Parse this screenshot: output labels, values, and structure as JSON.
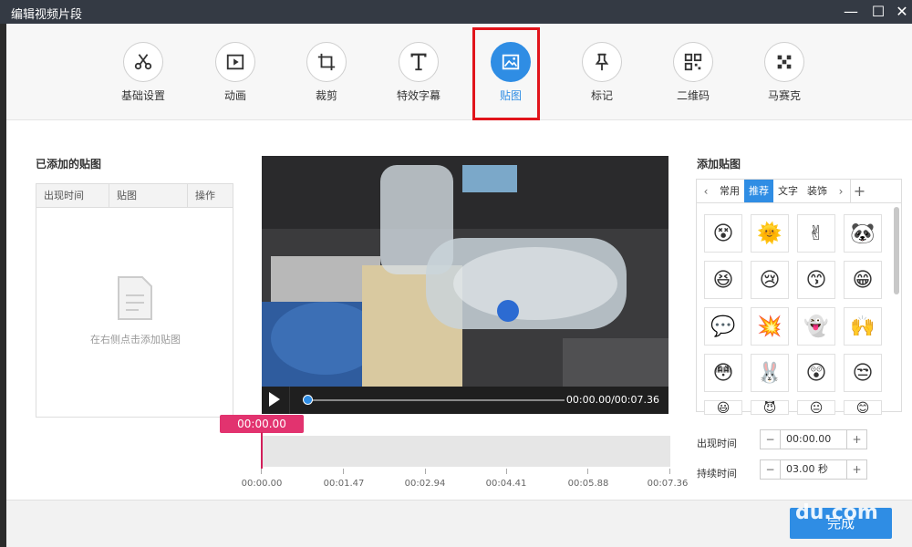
{
  "window": {
    "title": "编辑视频片段",
    "minimize_label": "—",
    "maximize_label": "☐",
    "close_label": "✕"
  },
  "toolbar": {
    "items": [
      {
        "label": "基础设置",
        "icon": "scissors-icon"
      },
      {
        "label": "动画",
        "icon": "play-box-icon"
      },
      {
        "label": "裁剪",
        "icon": "crop-icon"
      },
      {
        "label": "特效字幕",
        "icon": "text-icon"
      },
      {
        "label": "贴图",
        "icon": "image-icon"
      },
      {
        "label": "标记",
        "icon": "pin-icon"
      },
      {
        "label": "二维码",
        "icon": "qrcode-icon"
      },
      {
        "label": "马赛克",
        "icon": "mosaic-icon"
      }
    ],
    "active_index": 4
  },
  "added_stickers": {
    "title": "已添加的贴图",
    "columns": [
      "出现时间",
      "贴图",
      "操作"
    ],
    "empty_text": "在右侧点击添加贴图"
  },
  "player": {
    "time_display": "00:00.00/00:07.36",
    "progress": 0
  },
  "timeline": {
    "playhead_label": "00:00.00",
    "ticks": [
      "00:00.00",
      "00:01.47",
      "00:02.94",
      "00:04.41",
      "00:05.88",
      "00:07.36"
    ]
  },
  "sticker_library": {
    "title": "添加贴图",
    "prev_label": "‹",
    "next_label": "›",
    "add_label": "+",
    "tabs": [
      "常用",
      "推荐",
      "文字",
      "装饰"
    ],
    "active_tab": 1,
    "stickers": [
      "😵",
      "🌞",
      "✌",
      "🐼",
      "😆",
      "😢",
      "😙",
      "😁",
      "💬",
      "💥",
      "👻",
      "🙌",
      "😳",
      "🐰",
      "😲",
      "😒",
      "😃",
      "😈",
      "😐",
      "😊"
    ]
  },
  "settings": {
    "appear_time_label": "出现时间",
    "appear_time_value": "00:00.00",
    "duration_label": "持续时间",
    "duration_value": "03.00 秒",
    "minus_label": "−",
    "plus_label": "+"
  },
  "footer": {
    "done_label": "完成"
  },
  "watermark": {
    "text": "du.com"
  },
  "colors": {
    "accent": "#2f8de4",
    "highlight": "#e1141b",
    "playhead": "#e2336f"
  }
}
